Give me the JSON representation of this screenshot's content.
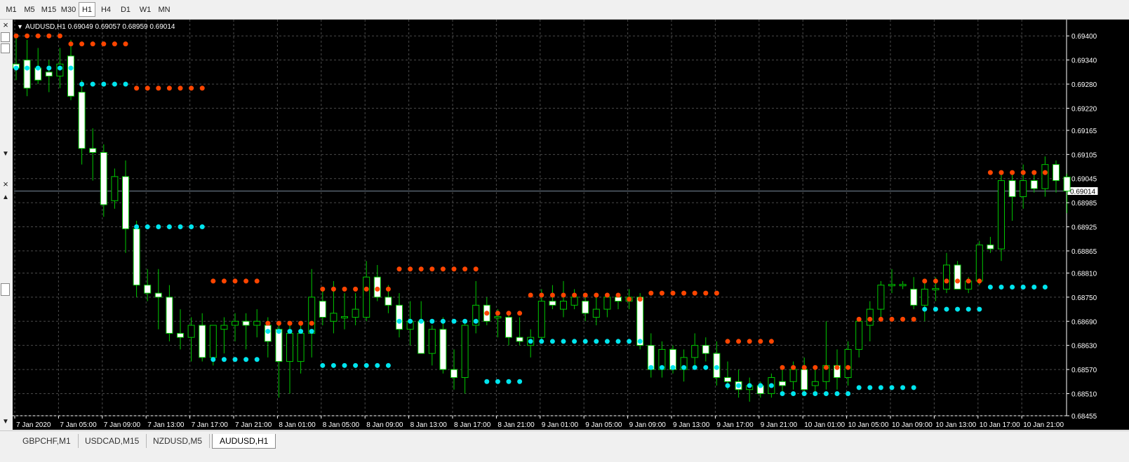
{
  "timeframes": [
    "M1",
    "M5",
    "M15",
    "M30",
    "H1",
    "H4",
    "D1",
    "W1",
    "MN"
  ],
  "active_timeframe": "H1",
  "left_panel": {
    "close1": "×",
    "close2": "×",
    "up": "▲",
    "down": "▼"
  },
  "chart": {
    "symbol_info": "AUDUSD,H1  0.69049 0.69057 0.68959 0.69014",
    "current_price": "0.69014",
    "colors": {
      "background": "#000000",
      "grid": "#4a4a4a",
      "bull_candle": "#00c800",
      "bear_body": "#ffffff",
      "resistance": "#ff4500",
      "support": "#00e5ee",
      "price_line": "#778899",
      "axis_text": "#ffffff"
    }
  },
  "chart_data": {
    "type": "candlestick",
    "symbol": "AUDUSD",
    "timeframe": "H1",
    "ylim": [
      0.68455,
      0.6943
    ],
    "y_ticks": [
      "0.69400",
      "0.69340",
      "0.69280",
      "0.69220",
      "0.69165",
      "0.69105",
      "0.69045",
      "0.68985",
      "0.68925",
      "0.68865",
      "0.68810",
      "0.68750",
      "0.68690",
      "0.68630",
      "0.68570",
      "0.68510",
      "0.68455"
    ],
    "x_ticks": [
      "7 Jan 2020",
      "7 Jan 05:00",
      "7 Jan 09:00",
      "7 Jan 13:00",
      "7 Jan 17:00",
      "7 Jan 21:00",
      "8 Jan 01:00",
      "8 Jan 05:00",
      "8 Jan 09:00",
      "8 Jan 13:00",
      "8 Jan 17:00",
      "8 Jan 21:00",
      "9 Jan 01:00",
      "9 Jan 05:00",
      "9 Jan 09:00",
      "9 Jan 13:00",
      "9 Jan 17:00",
      "9 Jan 21:00",
      "10 Jan 01:00",
      "10 Jan 05:00",
      "10 Jan 09:00",
      "10 Jan 13:00",
      "10 Jan 17:00",
      "10 Jan 21:00"
    ],
    "candles": [
      {
        "o": 0.6933,
        "h": 0.694,
        "l": 0.6929,
        "c": 0.6932
      },
      {
        "o": 0.6934,
        "h": 0.6939,
        "l": 0.6925,
        "c": 0.6927
      },
      {
        "o": 0.6932,
        "h": 0.6937,
        "l": 0.6928,
        "c": 0.6929
      },
      {
        "o": 0.6931,
        "h": 0.6934,
        "l": 0.6926,
        "c": 0.693
      },
      {
        "o": 0.693,
        "h": 0.6937,
        "l": 0.6927,
        "c": 0.6933
      },
      {
        "o": 0.6935,
        "h": 0.6939,
        "l": 0.6924,
        "c": 0.6925
      },
      {
        "o": 0.6926,
        "h": 0.6929,
        "l": 0.6908,
        "c": 0.6912
      },
      {
        "o": 0.6912,
        "h": 0.6917,
        "l": 0.6904,
        "c": 0.6911
      },
      {
        "o": 0.6911,
        "h": 0.6913,
        "l": 0.6895,
        "c": 0.6898
      },
      {
        "o": 0.6899,
        "h": 0.6907,
        "l": 0.6897,
        "c": 0.6905
      },
      {
        "o": 0.6905,
        "h": 0.6909,
        "l": 0.6886,
        "c": 0.6892
      },
      {
        "o": 0.6892,
        "h": 0.6894,
        "l": 0.6875,
        "c": 0.6878
      },
      {
        "o": 0.6878,
        "h": 0.6882,
        "l": 0.6874,
        "c": 0.6876
      },
      {
        "o": 0.6876,
        "h": 0.6882,
        "l": 0.6867,
        "c": 0.6875
      },
      {
        "o": 0.6875,
        "h": 0.6878,
        "l": 0.6864,
        "c": 0.6866
      },
      {
        "o": 0.6866,
        "h": 0.6872,
        "l": 0.6862,
        "c": 0.6865
      },
      {
        "o": 0.6865,
        "h": 0.687,
        "l": 0.6859,
        "c": 0.6868
      },
      {
        "o": 0.6868,
        "h": 0.6871,
        "l": 0.6859,
        "c": 0.686
      },
      {
        "o": 0.686,
        "h": 0.6868,
        "l": 0.6858,
        "c": 0.6868
      },
      {
        "o": 0.6867,
        "h": 0.687,
        "l": 0.6861,
        "c": 0.6868
      },
      {
        "o": 0.6868,
        "h": 0.6871,
        "l": 0.6864,
        "c": 0.6869
      },
      {
        "o": 0.6869,
        "h": 0.6871,
        "l": 0.6862,
        "c": 0.6868
      },
      {
        "o": 0.6868,
        "h": 0.6872,
        "l": 0.6865,
        "c": 0.6869
      },
      {
        "o": 0.6868,
        "h": 0.687,
        "l": 0.686,
        "c": 0.6864
      },
      {
        "o": 0.6867,
        "h": 0.6868,
        "l": 0.685,
        "c": 0.6859
      },
      {
        "o": 0.6859,
        "h": 0.6869,
        "l": 0.6851,
        "c": 0.6866
      },
      {
        "o": 0.6859,
        "h": 0.6868,
        "l": 0.6856,
        "c": 0.6866
      },
      {
        "o": 0.6866,
        "h": 0.6882,
        "l": 0.686,
        "c": 0.6875
      },
      {
        "o": 0.6874,
        "h": 0.6877,
        "l": 0.6868,
        "c": 0.687
      },
      {
        "o": 0.6869,
        "h": 0.6879,
        "l": 0.6866,
        "c": 0.6871
      },
      {
        "o": 0.687,
        "h": 0.6876,
        "l": 0.6867,
        "c": 0.687
      },
      {
        "o": 0.687,
        "h": 0.6876,
        "l": 0.6868,
        "c": 0.6872
      },
      {
        "o": 0.687,
        "h": 0.6884,
        "l": 0.6869,
        "c": 0.688
      },
      {
        "o": 0.688,
        "h": 0.6883,
        "l": 0.6874,
        "c": 0.6875
      },
      {
        "o": 0.6875,
        "h": 0.6878,
        "l": 0.6871,
        "c": 0.6873
      },
      {
        "o": 0.6873,
        "h": 0.6876,
        "l": 0.6865,
        "c": 0.6867
      },
      {
        "o": 0.6867,
        "h": 0.6874,
        "l": 0.6863,
        "c": 0.6869
      },
      {
        "o": 0.6869,
        "h": 0.6874,
        "l": 0.6862,
        "c": 0.6861
      },
      {
        "o": 0.6861,
        "h": 0.6868,
        "l": 0.6858,
        "c": 0.6867
      },
      {
        "o": 0.6867,
        "h": 0.687,
        "l": 0.6856,
        "c": 0.6857
      },
      {
        "o": 0.6857,
        "h": 0.6862,
        "l": 0.6852,
        "c": 0.6855
      },
      {
        "o": 0.6855,
        "h": 0.6869,
        "l": 0.6851,
        "c": 0.6868
      },
      {
        "o": 0.6868,
        "h": 0.6879,
        "l": 0.6866,
        "c": 0.6873
      },
      {
        "o": 0.6873,
        "h": 0.6875,
        "l": 0.6868,
        "c": 0.6869
      },
      {
        "o": 0.687,
        "h": 0.6872,
        "l": 0.6865,
        "c": 0.687
      },
      {
        "o": 0.687,
        "h": 0.6871,
        "l": 0.6863,
        "c": 0.6865
      },
      {
        "o": 0.6865,
        "h": 0.687,
        "l": 0.6863,
        "c": 0.6864
      },
      {
        "o": 0.6863,
        "h": 0.6867,
        "l": 0.686,
        "c": 0.6865
      },
      {
        "o": 0.6865,
        "h": 0.6877,
        "l": 0.6864,
        "c": 0.6874
      },
      {
        "o": 0.6874,
        "h": 0.6878,
        "l": 0.6872,
        "c": 0.6873
      },
      {
        "o": 0.6872,
        "h": 0.6879,
        "l": 0.687,
        "c": 0.6874
      },
      {
        "o": 0.6873,
        "h": 0.6877,
        "l": 0.6872,
        "c": 0.6875
      },
      {
        "o": 0.6874,
        "h": 0.6876,
        "l": 0.6869,
        "c": 0.6871
      },
      {
        "o": 0.687,
        "h": 0.6875,
        "l": 0.6868,
        "c": 0.6872
      },
      {
        "o": 0.6872,
        "h": 0.6876,
        "l": 0.687,
        "c": 0.6875
      },
      {
        "o": 0.6875,
        "h": 0.6876,
        "l": 0.6872,
        "c": 0.6874
      },
      {
        "o": 0.6874,
        "h": 0.6877,
        "l": 0.6872,
        "c": 0.6875
      },
      {
        "o": 0.6875,
        "h": 0.6876,
        "l": 0.6862,
        "c": 0.6863
      },
      {
        "o": 0.6863,
        "h": 0.6866,
        "l": 0.6855,
        "c": 0.6857
      },
      {
        "o": 0.6857,
        "h": 0.6864,
        "l": 0.6855,
        "c": 0.6862
      },
      {
        "o": 0.6862,
        "h": 0.6863,
        "l": 0.6856,
        "c": 0.6857
      },
      {
        "o": 0.6857,
        "h": 0.6862,
        "l": 0.6854,
        "c": 0.686
      },
      {
        "o": 0.686,
        "h": 0.6866,
        "l": 0.6858,
        "c": 0.6863
      },
      {
        "o": 0.6863,
        "h": 0.6865,
        "l": 0.6859,
        "c": 0.6861
      },
      {
        "o": 0.6861,
        "h": 0.6864,
        "l": 0.6853,
        "c": 0.6855
      },
      {
        "o": 0.6855,
        "h": 0.6859,
        "l": 0.6852,
        "c": 0.6854
      },
      {
        "o": 0.6854,
        "h": 0.6857,
        "l": 0.685,
        "c": 0.6852
      },
      {
        "o": 0.6852,
        "h": 0.6855,
        "l": 0.6849,
        "c": 0.6853
      },
      {
        "o": 0.6853,
        "h": 0.6854,
        "l": 0.685,
        "c": 0.6851
      },
      {
        "o": 0.6851,
        "h": 0.6856,
        "l": 0.685,
        "c": 0.6855
      },
      {
        "o": 0.6854,
        "h": 0.6858,
        "l": 0.6851,
        "c": 0.6853
      },
      {
        "o": 0.6854,
        "h": 0.6859,
        "l": 0.6852,
        "c": 0.6857
      },
      {
        "o": 0.6857,
        "h": 0.686,
        "l": 0.6851,
        "c": 0.6852
      },
      {
        "o": 0.6853,
        "h": 0.6858,
        "l": 0.6851,
        "c": 0.6854
      },
      {
        "o": 0.6854,
        "h": 0.6869,
        "l": 0.6852,
        "c": 0.6858
      },
      {
        "o": 0.6858,
        "h": 0.6862,
        "l": 0.6852,
        "c": 0.6855
      },
      {
        "o": 0.6855,
        "h": 0.6864,
        "l": 0.6853,
        "c": 0.6862
      },
      {
        "o": 0.6862,
        "h": 0.687,
        "l": 0.686,
        "c": 0.6869
      },
      {
        "o": 0.6868,
        "h": 0.6874,
        "l": 0.6864,
        "c": 0.6872
      },
      {
        "o": 0.6872,
        "h": 0.6879,
        "l": 0.6869,
        "c": 0.6878
      },
      {
        "o": 0.6878,
        "h": 0.6882,
        "l": 0.6876,
        "c": 0.6878
      },
      {
        "o": 0.6878,
        "h": 0.6879,
        "l": 0.6877,
        "c": 0.6878
      },
      {
        "o": 0.6877,
        "h": 0.688,
        "l": 0.6872,
        "c": 0.6873
      },
      {
        "o": 0.6873,
        "h": 0.6879,
        "l": 0.6869,
        "c": 0.6877
      },
      {
        "o": 0.6877,
        "h": 0.688,
        "l": 0.6874,
        "c": 0.6877
      },
      {
        "o": 0.6877,
        "h": 0.6886,
        "l": 0.6876,
        "c": 0.6883
      },
      {
        "o": 0.6883,
        "h": 0.6884,
        "l": 0.6877,
        "c": 0.6877
      },
      {
        "o": 0.6877,
        "h": 0.688,
        "l": 0.6876,
        "c": 0.6879
      },
      {
        "o": 0.6879,
        "h": 0.6889,
        "l": 0.6878,
        "c": 0.6888
      },
      {
        "o": 0.6888,
        "h": 0.689,
        "l": 0.6886,
        "c": 0.6887
      },
      {
        "o": 0.6887,
        "h": 0.6906,
        "l": 0.6884,
        "c": 0.6904
      },
      {
        "o": 0.6904,
        "h": 0.6906,
        "l": 0.6894,
        "c": 0.69
      },
      {
        "o": 0.69,
        "h": 0.6908,
        "l": 0.6897,
        "c": 0.6904
      },
      {
        "o": 0.6904,
        "h": 0.6906,
        "l": 0.6901,
        "c": 0.6902
      },
      {
        "o": 0.6902,
        "h": 0.691,
        "l": 0.69,
        "c": 0.6908
      },
      {
        "o": 0.6908,
        "h": 0.6909,
        "l": 0.6901,
        "c": 0.6904
      },
      {
        "o": 0.69049,
        "h": 0.69057,
        "l": 0.68959,
        "c": 0.69014
      }
    ],
    "resistance_dots": [
      {
        "from": 0,
        "to": 4,
        "y": 0.694
      },
      {
        "from": 5,
        "to": 10,
        "y": 0.6938
      },
      {
        "from": 11,
        "to": 17,
        "y": 0.6927
      },
      {
        "from": 18,
        "to": 22,
        "y": 0.6879
      },
      {
        "from": 23,
        "to": 27,
        "y": 0.68685
      },
      {
        "from": 28,
        "to": 34,
        "y": 0.6877
      },
      {
        "from": 35,
        "to": 42,
        "y": 0.6882
      },
      {
        "from": 43,
        "to": 46,
        "y": 0.6871
      },
      {
        "from": 47,
        "to": 55,
        "y": 0.68755
      },
      {
        "from": 56,
        "to": 57,
        "y": 0.68745
      },
      {
        "from": 58,
        "to": 64,
        "y": 0.6876
      },
      {
        "from": 65,
        "to": 69,
        "y": 0.6864
      },
      {
        "from": 70,
        "to": 76,
        "y": 0.68575
      },
      {
        "from": 77,
        "to": 82,
        "y": 0.68695
      },
      {
        "from": 83,
        "to": 88,
        "y": 0.6879
      },
      {
        "from": 89,
        "to": 94,
        "y": 0.6906
      }
    ],
    "support_dots": [
      {
        "from": 0,
        "to": 5,
        "y": 0.6932
      },
      {
        "from": 6,
        "to": 10,
        "y": 0.6928
      },
      {
        "from": 11,
        "to": 17,
        "y": 0.68925
      },
      {
        "from": 18,
        "to": 22,
        "y": 0.68595
      },
      {
        "from": 23,
        "to": 27,
        "y": 0.68665
      },
      {
        "from": 28,
        "to": 34,
        "y": 0.6858
      },
      {
        "from": 35,
        "to": 42,
        "y": 0.6869
      },
      {
        "from": 43,
        "to": 46,
        "y": 0.6854
      },
      {
        "from": 47,
        "to": 57,
        "y": 0.6864
      },
      {
        "from": 58,
        "to": 64,
        "y": 0.68575
      },
      {
        "from": 65,
        "to": 69,
        "y": 0.6853
      },
      {
        "from": 70,
        "to": 76,
        "y": 0.6851
      },
      {
        "from": 77,
        "to": 82,
        "y": 0.68525
      },
      {
        "from": 83,
        "to": 88,
        "y": 0.6872
      },
      {
        "from": 89,
        "to": 94,
        "y": 0.68775
      }
    ]
  },
  "tabs": [
    "GBPCHF,M1",
    "USDCAD,M15",
    "NZDUSD,M5",
    "AUDUSD,H1"
  ],
  "active_tab": "AUDUSD,H1"
}
